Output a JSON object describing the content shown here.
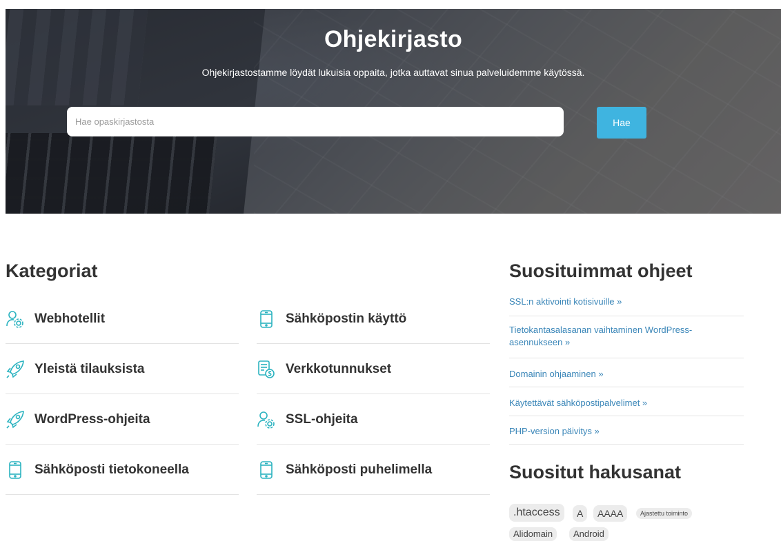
{
  "hero": {
    "title": "Ohjekirjasto",
    "subtitle": "Ohjekirjastostamme löydät lukuisia oppaita, jotka auttavat sinua palveluidemme käytössä.",
    "search_placeholder": "Hae opaskirjastosta",
    "search_button": "Hae"
  },
  "categories": {
    "title": "Kategoriat",
    "items": [
      {
        "label": "Webhotellit",
        "icon": "gear-user-icon"
      },
      {
        "label": "Sähköpostin käyttö",
        "icon": "phone-icon"
      },
      {
        "label": "Yleistä tilauksista",
        "icon": "rocket-icon"
      },
      {
        "label": "Verkkotunnukset",
        "icon": "invoice-icon"
      },
      {
        "label": "WordPress-ohjeita",
        "icon": "rocket-icon"
      },
      {
        "label": "SSL-ohjeita",
        "icon": "gear-user-icon"
      },
      {
        "label": "Sähköposti tietokoneella",
        "icon": "phone-icon"
      },
      {
        "label": "Sähköposti puhelimella",
        "icon": "phone-icon"
      }
    ]
  },
  "popular": {
    "title": "Suosituimmat ohjeet",
    "items": [
      "SSL:n aktivointi kotisivuille »",
      "Tietokantasalasanan vaihtaminen WordPress-asennukseen »",
      "Domainin ohjaaminen »",
      "Käytettävät sähköpostipalvelimet »",
      "PHP-version päivitys »"
    ]
  },
  "tags": {
    "title": "Suositut hakusanat",
    "items": [
      ".htaccess",
      "A",
      "AAAA",
      "Ajastettu toiminto",
      "Alidomain",
      "Android"
    ]
  },
  "colors": {
    "accent": "#3fb4e0",
    "icon": "#2bb3c0",
    "link": "#3a86b8"
  }
}
